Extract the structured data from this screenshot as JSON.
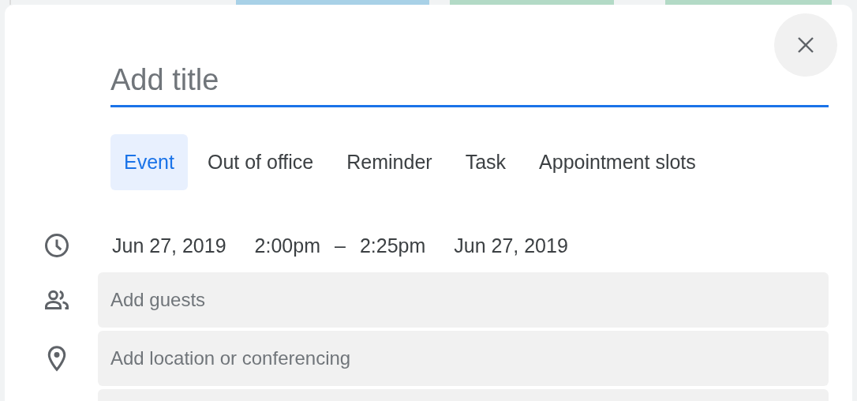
{
  "title_field": {
    "placeholder": "Add title"
  },
  "tabs": [
    {
      "label": "Event",
      "selected": true
    },
    {
      "label": "Out of office",
      "selected": false
    },
    {
      "label": "Reminder",
      "selected": false
    },
    {
      "label": "Task",
      "selected": false
    },
    {
      "label": "Appointment slots",
      "selected": false
    }
  ],
  "time": {
    "start_date": "Jun 27, 2019",
    "start_time": "2:00pm",
    "separator": "–",
    "end_time": "2:25pm",
    "end_date": "Jun 27, 2019"
  },
  "fields": [
    {
      "kind": "guests",
      "placeholder": "Add guests"
    },
    {
      "kind": "location",
      "placeholder": "Add location or conferencing"
    },
    {
      "kind": "more"
    }
  ]
}
